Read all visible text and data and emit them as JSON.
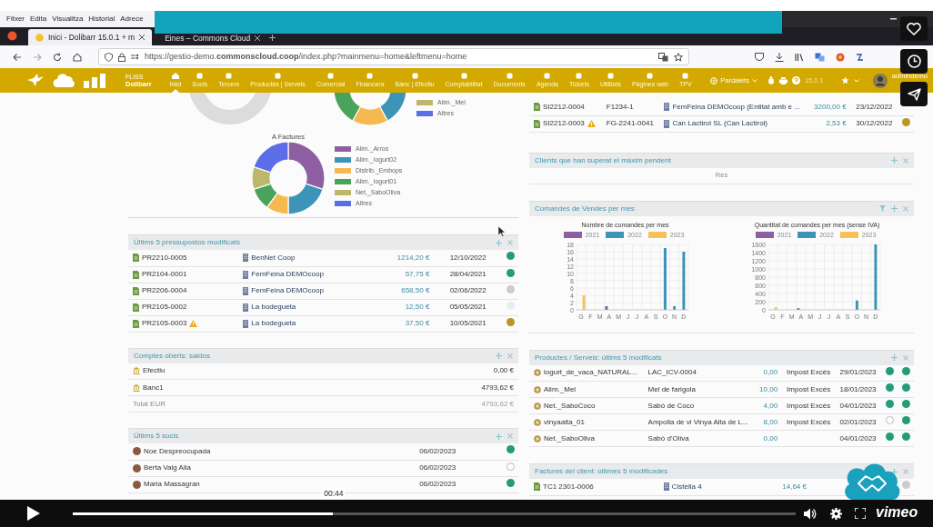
{
  "browser": {
    "menu": [
      "Fitxer",
      "Edita",
      "Visualitza",
      "Historial",
      "Adrece"
    ],
    "tabs": [
      {
        "title": "Inici - Dolibarr 15.0.1 + m",
        "selected": true
      },
      {
        "title": "Eines – Commons Cloud",
        "selected": false
      }
    ],
    "url": "https://gestio-demo.**commonscloud.coop**/index.php?mainmenu=home&leftmenu=home"
  },
  "app_bar": {
    "brand_tag": "FLISS",
    "brand": "Dolibarr",
    "menu": [
      {
        "label": "Inici",
        "selected": true
      },
      {
        "label": "Socis",
        "selected": false
      },
      {
        "label": "Tercers",
        "selected": false
      },
      {
        "label": "Productes | Serveis",
        "selected": false
      },
      {
        "label": "Comercial",
        "selected": false
      },
      {
        "label": "Financera",
        "selected": false
      },
      {
        "label": "Banc | Efectiu",
        "selected": false
      },
      {
        "label": "Comptabilitat",
        "selected": false
      },
      {
        "label": "Documents",
        "selected": false
      },
      {
        "label": "Agenda",
        "selected": false
      },
      {
        "label": "Tickets",
        "selected": false
      },
      {
        "label": "Utilitats",
        "selected": false
      },
      {
        "label": "Pàgines web",
        "selected": false
      },
      {
        "label": "TPV",
        "selected": false
      }
    ],
    "entity": "Pardalets",
    "version": "15.0.1",
    "user": "admindemo"
  },
  "left_column": [
    {
      "kind": "donuts",
      "top_legend": [
        {
          "label": "Alim._Mel",
          "color": "#bdb76b"
        },
        {
          "label": "Altres",
          "color": "#5b6ee8"
        }
      ],
      "title": "A Factures",
      "legend": [
        {
          "label": "Alim._Arros",
          "color": "#8e5ea2"
        },
        {
          "label": "Alim._Iogurt02",
          "color": "#3c95b8"
        },
        {
          "label": "Distrib._Embops",
          "color": "#f6b94f"
        },
        {
          "label": "Alim._Iogurt01",
          "color": "#4aa35a"
        },
        {
          "label": "Net._SaboOliva",
          "color": "#bdb76b"
        },
        {
          "label": "Altres",
          "color": "#5b6ee8"
        }
      ]
    },
    {
      "kind": "table",
      "title": "Últims 5 pressupostos modificats",
      "rows": [
        {
          "cells": [
            {
              "kind": "ref",
              "text": "PR2210-0005",
              "warning": false
            },
            {
              "kind": "company",
              "text": "BenNet Coop"
            },
            {
              "kind": "amount",
              "text": "1214,20 €"
            },
            {
              "kind": "date",
              "text": "12/10/2022"
            }
          ],
          "dots": [
            {
              "color": "#259b7c"
            }
          ]
        },
        {
          "cells": [
            {
              "kind": "ref",
              "text": "PR2104-0001",
              "warning": false
            },
            {
              "kind": "company",
              "text": "FemFeina DEMOcoop"
            },
            {
              "kind": "amount",
              "text": "57,75 €"
            },
            {
              "kind": "date",
              "text": "28/04/2021"
            }
          ],
          "dots": [
            {
              "color": "#259b7c"
            }
          ]
        },
        {
          "cells": [
            {
              "kind": "ref",
              "text": "PR2206-0004",
              "warning": false
            },
            {
              "kind": "company",
              "text": "FemFeina DEMOcoop"
            },
            {
              "kind": "amount",
              "text": "658,50 €"
            },
            {
              "kind": "date",
              "text": "02/06/2022"
            }
          ],
          "dots": [
            {
              "color": "#cccccc"
            }
          ]
        },
        {
          "cells": [
            {
              "kind": "ref",
              "text": "PR2105-0002",
              "warning": false
            },
            {
              "kind": "company",
              "text": "La bodegueta"
            },
            {
              "kind": "amount",
              "text": "12,50 €"
            },
            {
              "kind": "date",
              "text": "05/05/2021"
            }
          ],
          "dots": [
            {
              "color": "#e8edf0"
            }
          ]
        },
        {
          "cells": [
            {
              "kind": "ref",
              "text": "PR2105-0003",
              "warning": true
            },
            {
              "kind": "company",
              "text": "La bodegueta"
            },
            {
              "kind": "amount",
              "text": "37,50 €"
            },
            {
              "kind": "date",
              "text": "10/05/2021"
            }
          ],
          "dots": [
            {
              "color": "#bc9526"
            }
          ]
        }
      ]
    },
    {
      "kind": "table",
      "title": "Comptes oberts: saldos",
      "rows": [
        {
          "cells": [
            {
              "kind": "bank",
              "text": "Efectiu"
            },
            {
              "kind": "value",
              "text": "0,00 €"
            }
          ],
          "dots": []
        },
        {
          "cells": [
            {
              "kind": "bank",
              "text": "Banc1"
            },
            {
              "kind": "value",
              "text": "4793,62 €"
            }
          ],
          "dots": []
        },
        {
          "cells": [
            {
              "kind": "muted",
              "text": "Total EUR"
            },
            {
              "kind": "muted_value",
              "text": "4793,62 €"
            }
          ],
          "dots": []
        }
      ]
    },
    {
      "kind": "table",
      "title": "Últims 5 socis",
      "rows": [
        {
          "cells": [
            {
              "kind": "person",
              "text": "Noe Despreocupada"
            },
            {
              "kind": "date",
              "text": "06/02/2023"
            }
          ],
          "dots": [
            {
              "color": "#259b7c"
            }
          ]
        },
        {
          "cells": [
            {
              "kind": "person",
              "text": "Berta Vaig Alla"
            },
            {
              "kind": "date",
              "text": "06/02/2023"
            }
          ],
          "dots": [
            {
              "color": "#ffffff"
            }
          ]
        },
        {
          "cells": [
            {
              "kind": "person",
              "text": "Maria Massagran"
            },
            {
              "kind": "date",
              "text": "06/02/2023"
            }
          ],
          "dots": [
            {
              "color": "#259b7c"
            }
          ]
        }
      ]
    }
  ],
  "right_column": [
    {
      "kind": "table",
      "rows": [
        {
          "cells": [
            {
              "kind": "ref",
              "text": "SI2212-0004",
              "warning": false
            },
            {
              "kind": "text",
              "text": "F1234-1"
            },
            {
              "kind": "company",
              "text": "FemFeina DEMOcoop (Entitat amb e ..."
            },
            {
              "kind": "amount",
              "text": "3200,00 €"
            },
            {
              "kind": "date",
              "text": "23/12/2022"
            }
          ],
          "dots": []
        },
        {
          "cells": [
            {
              "kind": "ref",
              "text": "SI2212-0003",
              "warning": true
            },
            {
              "kind": "text",
              "text": "FG-2241-0041"
            },
            {
              "kind": "company",
              "text": "Can Lactirol SL (Can Lactirol)"
            },
            {
              "kind": "amount",
              "text": "2,53 €"
            },
            {
              "kind": "date",
              "text": "30/12/2022"
            }
          ],
          "dots": [
            {
              "color": "#bc9526"
            }
          ]
        }
      ]
    },
    {
      "kind": "empty",
      "title": "Clients que han superat el màxim pendent",
      "text": "Res"
    },
    {
      "kind": "charts",
      "title": "Comandes de Vendes per mes",
      "charts": [
        {
          "chart_data": {
            "type": "bar",
            "grid": true,
            "legend": "top",
            "title": "Nombre de comandes per mes",
            "categories": [
              "G",
              "F",
              "M",
              "A",
              "M",
              "J",
              "J",
              "A",
              "S",
              "O",
              "N",
              "D"
            ],
            "ylim": [
              0,
              18
            ],
            "yticks": [
              0,
              2,
              4,
              6,
              8,
              10,
              12,
              14,
              16,
              18
            ],
            "series": [
              {
                "name": "2021",
                "color": "#8e5ea2",
                "values": [
                  0,
                  0,
                  0,
                  1,
                  0,
                  0,
                  0,
                  0,
                  0,
                  0,
                  0,
                  0
                ]
              },
              {
                "name": "2022",
                "color": "#3c95b8",
                "values": [
                  0,
                  0,
                  0,
                  0,
                  0,
                  0,
                  0,
                  0,
                  0,
                  17,
                  1,
                  16
                ]
              },
              {
                "name": "2023",
                "color": "#f6c15b",
                "values": [
                  4,
                  0,
                  0,
                  0,
                  0,
                  0,
                  0,
                  0,
                  0,
                  0,
                  0,
                  0
                ]
              }
            ]
          }
        },
        {
          "chart_data": {
            "type": "bar",
            "grid": true,
            "legend": "top",
            "title": "Quantitat de comandes per mes (sense IVA)",
            "categories": [
              "G",
              "F",
              "M",
              "A",
              "M",
              "J",
              "J",
              "A",
              "S",
              "O",
              "N",
              "D"
            ],
            "ylim": [
              0,
              1600
            ],
            "yticks": [
              0,
              200,
              400,
              600,
              800,
              1000,
              1200,
              1400,
              1600
            ],
            "series": [
              {
                "name": "2021",
                "color": "#8e5ea2",
                "values": [
                  0,
                  0,
                  0,
                  40,
                  0,
                  0,
                  0,
                  0,
                  0,
                  0,
                  0,
                  0
                ]
              },
              {
                "name": "2022",
                "color": "#3c95b8",
                "values": [
                  0,
                  0,
                  0,
                  0,
                  0,
                  0,
                  0,
                  0,
                  0,
                  230,
                  0,
                  1600
                ]
              },
              {
                "name": "2023",
                "color": "#f6c15b",
                "values": [
                  60,
                  0,
                  0,
                  0,
                  0,
                  0,
                  0,
                  0,
                  0,
                  0,
                  0,
                  0
                ]
              }
            ]
          }
        }
      ]
    },
    {
      "kind": "table",
      "title": "Productes / Serveis: últims 5 modificats",
      "rows": [
        {
          "cells": [
            {
              "kind": "product",
              "text": "iogurt_de_vaca_NATURAL..."
            },
            {
              "kind": "text",
              "text": "LAC_ICV-0004"
            },
            {
              "kind": "amount",
              "text": "0,00"
            },
            {
              "kind": "text",
              "text": "Impost Excés"
            },
            {
              "kind": "date",
              "text": "29/01/2023"
            }
          ],
          "dots": [
            {
              "color": "#259b7c"
            },
            {
              "color": "#259b7c"
            }
          ]
        },
        {
          "cells": [
            {
              "kind": "product",
              "text": "Alim._Mel"
            },
            {
              "kind": "text",
              "text": "Mel de farigola"
            },
            {
              "kind": "amount",
              "text": "10,00"
            },
            {
              "kind": "text",
              "text": "Impost Excés"
            },
            {
              "kind": "date",
              "text": "18/01/2023"
            }
          ],
          "dots": [
            {
              "color": "#259b7c"
            },
            {
              "color": "#259b7c"
            }
          ]
        },
        {
          "cells": [
            {
              "kind": "product",
              "text": "Net._SaboCoco"
            },
            {
              "kind": "text",
              "text": "Sabó de Coco"
            },
            {
              "kind": "amount",
              "text": "4,00"
            },
            {
              "kind": "text",
              "text": "Impost Excés"
            },
            {
              "kind": "date",
              "text": "04/01/2023"
            }
          ],
          "dots": [
            {
              "color": "#259b7c"
            },
            {
              "color": "#259b7c"
            }
          ]
        },
        {
          "cells": [
            {
              "kind": "product",
              "text": "vinyaalta_01"
            },
            {
              "kind": "text",
              "text": "Ampolla de vi Vinya Alta de L..."
            },
            {
              "kind": "amount",
              "text": "8,00"
            },
            {
              "kind": "text",
              "text": "Impost Excés"
            },
            {
              "kind": "date",
              "text": "02/01/2023"
            }
          ],
          "dots": [
            {
              "color": "#ffffff"
            },
            {
              "color": "#259b7c"
            }
          ]
        },
        {
          "cells": [
            {
              "kind": "product",
              "text": "Net._SaboOliva"
            },
            {
              "kind": "text",
              "text": "Sabó d'Oliva"
            },
            {
              "kind": "amount",
              "text": "0,00"
            },
            {
              "kind": "blank"
            },
            {
              "kind": "date",
              "text": "04/01/2023"
            }
          ],
          "dots": [
            {
              "color": "#259b7c"
            },
            {
              "color": "#259b7c"
            }
          ]
        }
      ]
    },
    {
      "kind": "table",
      "title": "Factures del client: últimes 5 modificades",
      "rows": [
        {
          "cells": [
            {
              "kind": "ref",
              "text": "TC1 2301-0006",
              "warning": false
            },
            {
              "kind": "company",
              "text": "Cistella 4"
            },
            {
              "kind": "amount",
              "text": "14,64 €"
            },
            {
              "kind": "blank"
            }
          ],
          "dots": [
            {
              "color": "#cccccc"
            }
          ]
        }
      ]
    }
  ],
  "video_player": {
    "time": "00:44",
    "level": 0.36,
    "logo": "vimeo"
  }
}
